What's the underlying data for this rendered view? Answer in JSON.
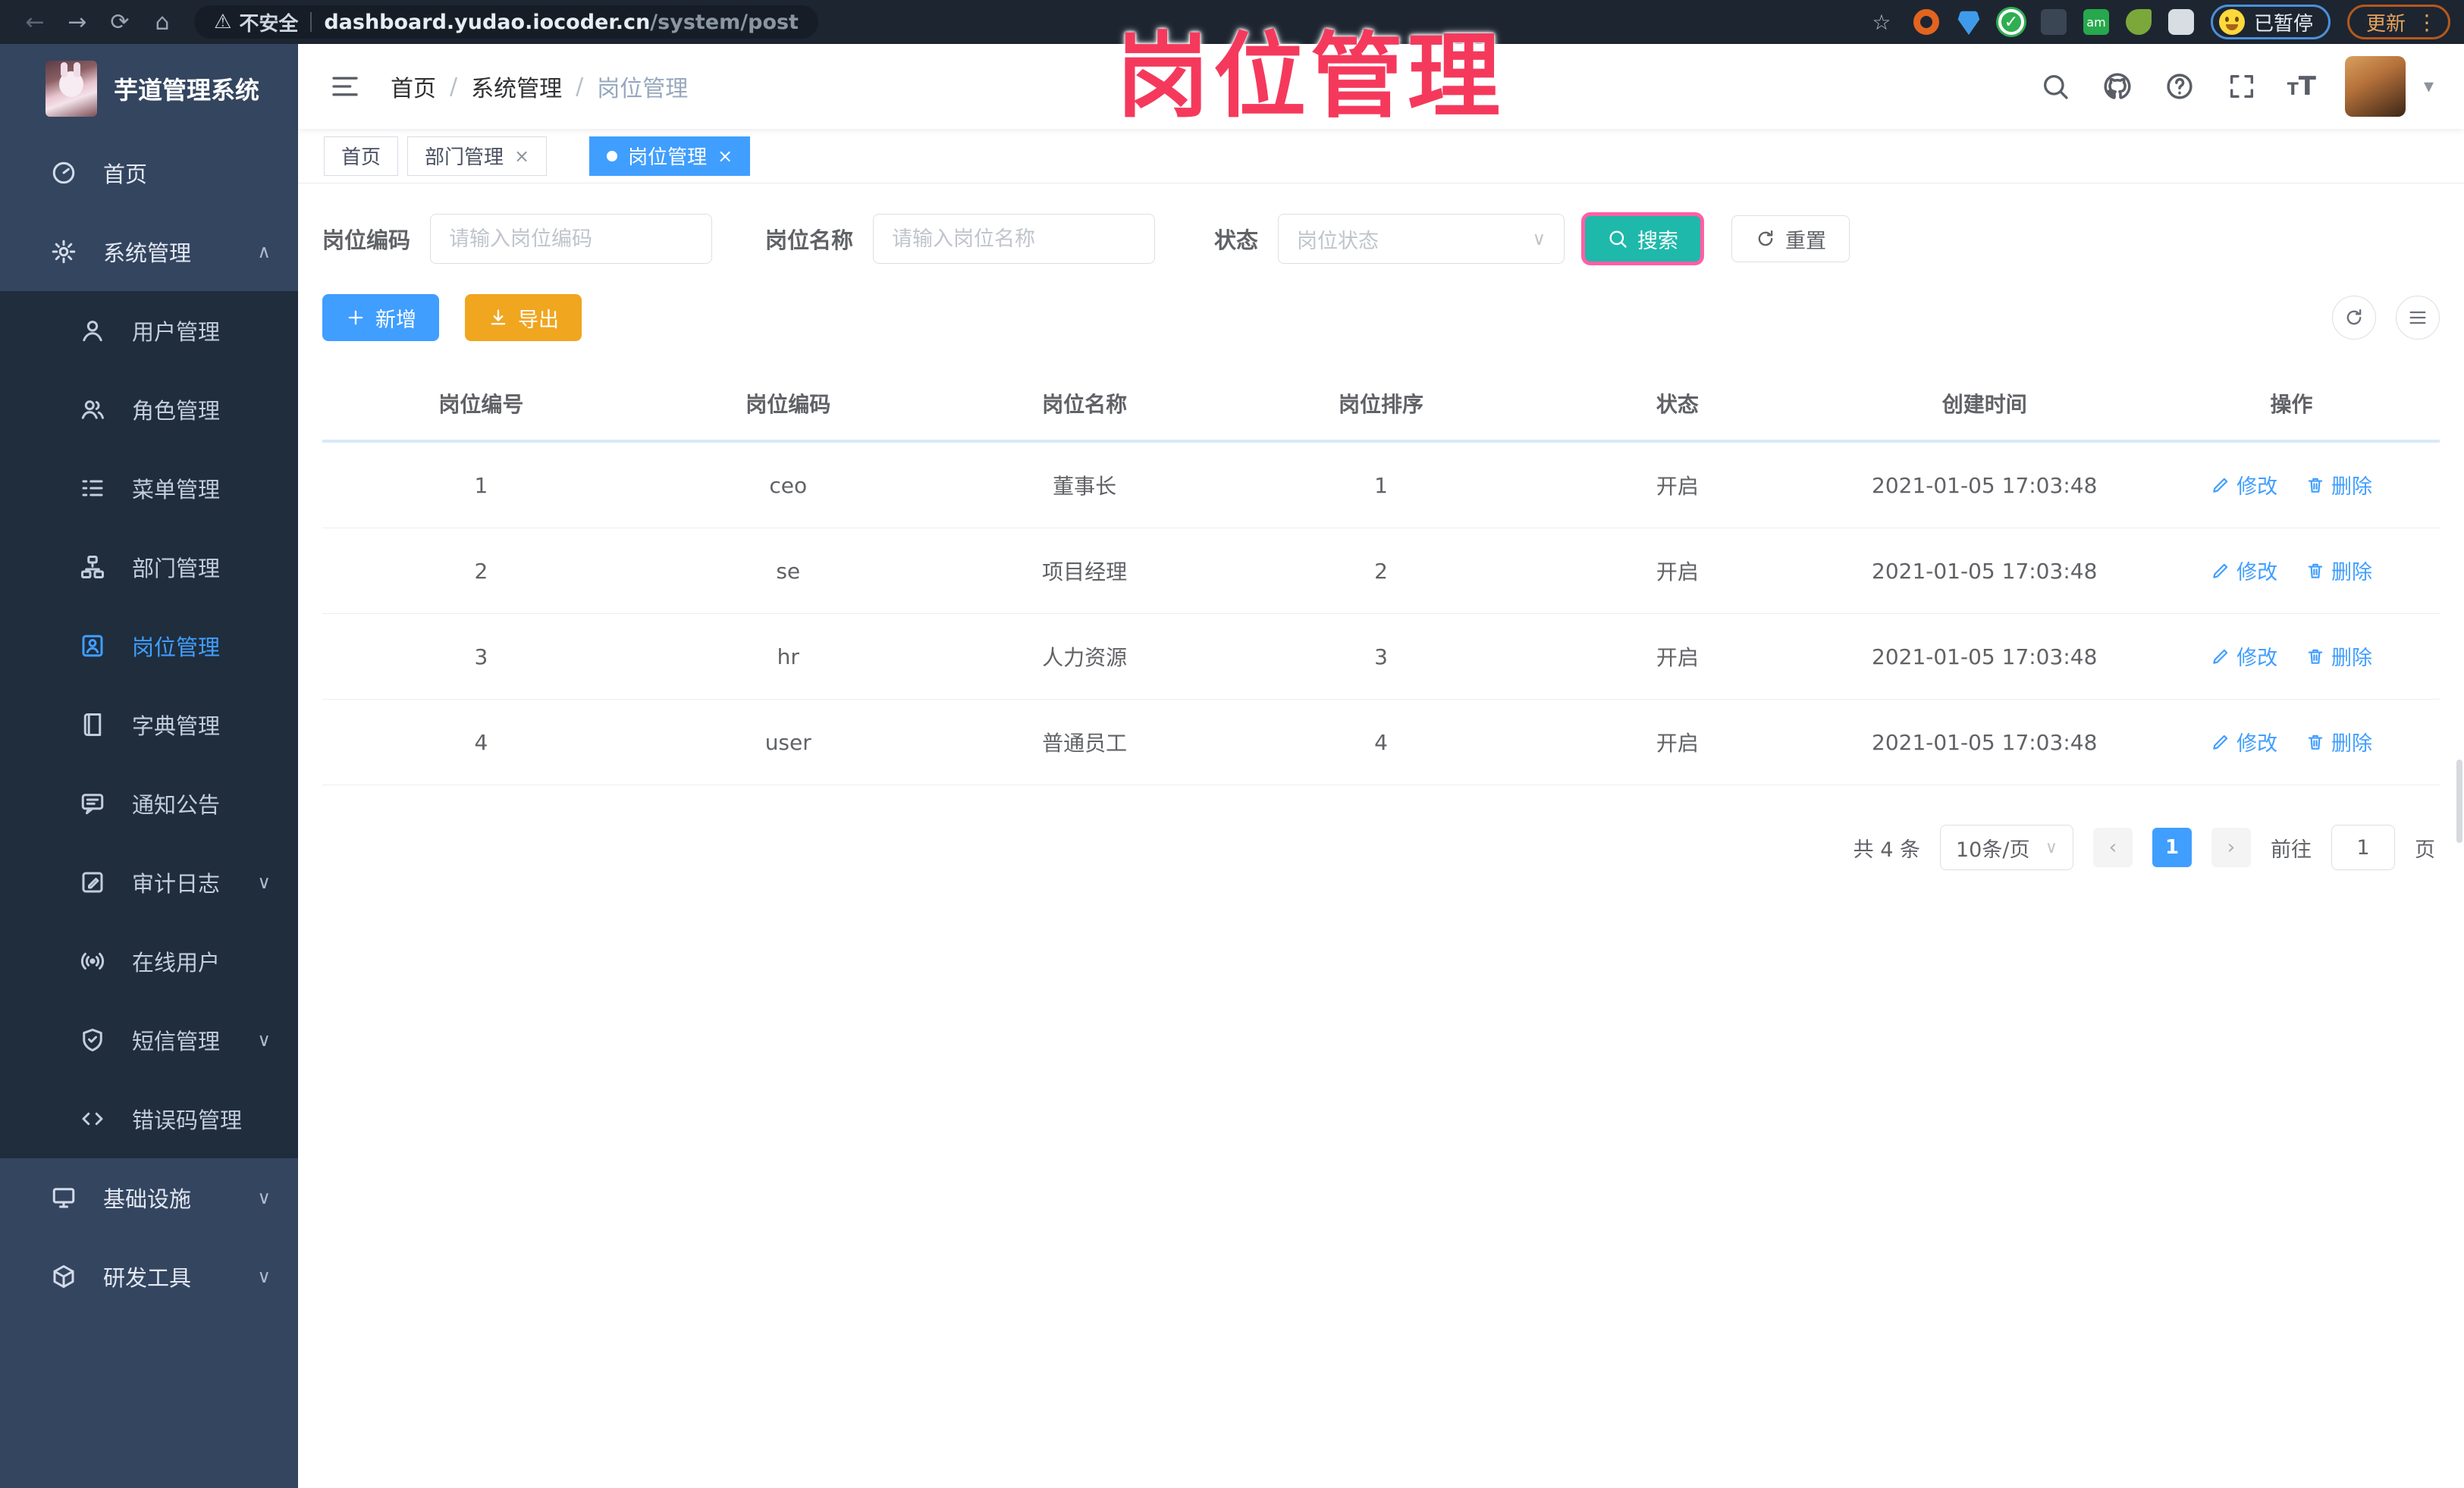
{
  "browser": {
    "back": "←",
    "forward": "→",
    "reload": "⟳",
    "home": "⌂",
    "warning_icon": "⚠",
    "security_label": "不安全",
    "url_host": "dashboard.yudao.iocoder.cn",
    "url_path": "/system/post",
    "star_icon": "☆",
    "paused_label": "已暂停",
    "update_label": "更新",
    "kebab_icon": "⋮"
  },
  "app": {
    "title": "芋道管理系统"
  },
  "watermark": "岗位管理",
  "sidebar": {
    "items": [
      {
        "label": "首页",
        "icon": "dashboard",
        "level": "top"
      },
      {
        "label": "系统管理",
        "icon": "gear",
        "level": "top",
        "arrow": "∧",
        "expanded": true
      },
      {
        "label": "用户管理",
        "icon": "user",
        "level": "sub"
      },
      {
        "label": "角色管理",
        "icon": "role",
        "level": "sub"
      },
      {
        "label": "菜单管理",
        "icon": "menu-list",
        "level": "sub"
      },
      {
        "label": "部门管理",
        "icon": "org-tree",
        "level": "sub"
      },
      {
        "label": "岗位管理",
        "icon": "id-badge",
        "level": "sub",
        "active": true
      },
      {
        "label": "字典管理",
        "icon": "book",
        "level": "sub"
      },
      {
        "label": "通知公告",
        "icon": "notice-bubble",
        "level": "sub"
      },
      {
        "label": "审计日志",
        "icon": "edit-square",
        "level": "sub",
        "arrow": "∨"
      },
      {
        "label": "在线用户",
        "icon": "signal",
        "level": "sub"
      },
      {
        "label": "短信管理",
        "icon": "shield",
        "level": "sub",
        "arrow": "∨"
      },
      {
        "label": "错误码管理",
        "icon": "code",
        "level": "sub"
      },
      {
        "label": "基础设施",
        "icon": "monitor",
        "level": "top",
        "arrow": "∨"
      },
      {
        "label": "研发工具",
        "icon": "cube",
        "level": "top",
        "arrow": "∨"
      }
    ]
  },
  "breadcrumb": {
    "items": [
      "首页",
      "系统管理",
      "岗位管理"
    ],
    "separator": "/"
  },
  "header_icons": {
    "font_big": "T",
    "font_small": "T",
    "caret": "▾",
    "question": "?"
  },
  "tabs": [
    {
      "label": "首页",
      "closable": false,
      "active": false
    },
    {
      "label": "部门管理",
      "closable": true,
      "active": false,
      "close": "×"
    },
    {
      "label": "岗位管理",
      "closable": true,
      "active": true,
      "close": "×"
    }
  ],
  "filters": {
    "code_label": "岗位编码",
    "code_placeholder": "请输入岗位编码",
    "name_label": "岗位名称",
    "name_placeholder": "请输入岗位名称",
    "status_label": "状态",
    "status_placeholder": "岗位状态",
    "status_chevron": "∨",
    "search_label": "搜索",
    "reset_label": "重置"
  },
  "toolbar": {
    "add_label": "新增",
    "export_label": "导出"
  },
  "table": {
    "headers": [
      "岗位编号",
      "岗位编码",
      "岗位名称",
      "岗位排序",
      "状态",
      "创建时间",
      "操作"
    ],
    "edit_label": "修改",
    "delete_label": "删除",
    "rows": [
      {
        "id": "1",
        "code": "ceo",
        "name": "董事长",
        "sort": "1",
        "status": "开启",
        "created": "2021-01-05 17:03:48"
      },
      {
        "id": "2",
        "code": "se",
        "name": "项目经理",
        "sort": "2",
        "status": "开启",
        "created": "2021-01-05 17:03:48"
      },
      {
        "id": "3",
        "code": "hr",
        "name": "人力资源",
        "sort": "3",
        "status": "开启",
        "created": "2021-01-05 17:03:48"
      },
      {
        "id": "4",
        "code": "user",
        "name": "普通员工",
        "sort": "4",
        "status": "开启",
        "created": "2021-01-05 17:03:48"
      }
    ]
  },
  "pagination": {
    "total_label": "共 4 条",
    "page_size_label": "10条/页",
    "chevron": "∨",
    "prev": "‹",
    "next": "›",
    "current_page": "1",
    "goto_label": "前往",
    "goto_value": "1",
    "page_suffix": "页"
  },
  "colors": {
    "accent_blue": "#409eff",
    "search_teal": "#1eb9aa",
    "export_orange": "#f0a61f",
    "watermark_pink": "#f5395c",
    "sidebar_bg": "#344560",
    "submenu_bg": "#1f2d3d",
    "annotation_ring_pink": "#ff5fa5"
  }
}
